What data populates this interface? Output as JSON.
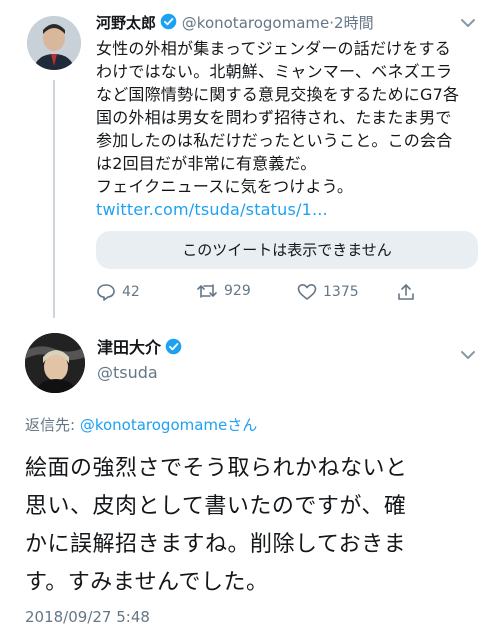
{
  "tweet1": {
    "author_name": "河野太郎",
    "handle": "@konotarogomame",
    "time": "2時間",
    "text_lines": [
      "女性の外相が集まってジェンダーの話だけをする",
      "わけではない。北朝鮮、ミャンマー、ベネズエラ",
      "など国際情勢に関する意見交換をするためにG7各",
      "国の外相は男女を問わず招待され、たまたま男で",
      "参加したのは私だけだったということ。この会合",
      "は2回目だが非常に有意義だ。",
      "フェイクニュースに気をつけよう。"
    ],
    "link": "twitter.com/tsuda/status/1...",
    "unavailable_notice": "このツイートは表示できません",
    "reply_count": "42",
    "retweet_count": "929",
    "like_count": "1375"
  },
  "tweet2": {
    "author_name": "津田大介",
    "handle": "@tsuda",
    "reply_to_label": "返信先: ",
    "reply_to_handle": "@konotarogomameさん",
    "text_lines": [
      "絵面の強烈さでそう取られかねないと",
      "思い、皮肉として書いたのですが、確",
      "かに誤解招きますね。削除しておきま",
      "す。すみませんでした。"
    ],
    "timestamp": "2018/09/27 5:48"
  },
  "colors": {
    "accent": "#1da1f2",
    "secondary_text": "#657786",
    "thread_line": "#ccd6dd",
    "notice_bg": "#e9eef2"
  }
}
